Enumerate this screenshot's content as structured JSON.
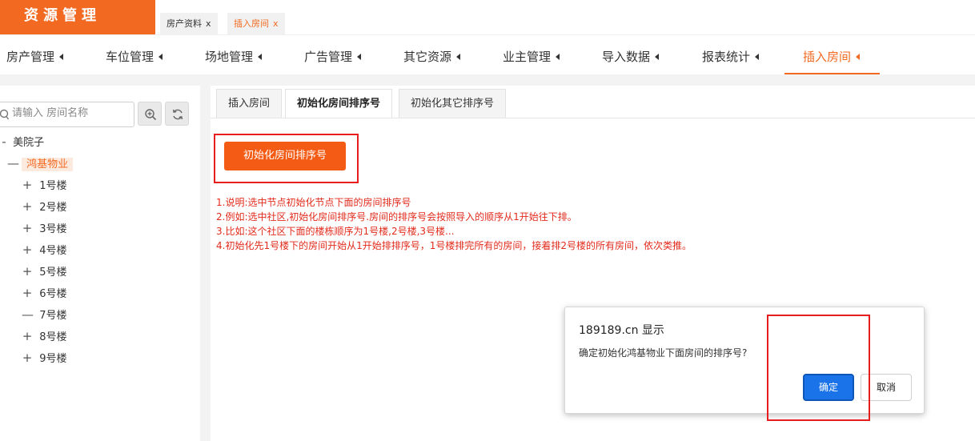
{
  "app": {
    "title": "资源管理"
  },
  "window_tabs": [
    {
      "label": "房产资料",
      "close": "x"
    },
    {
      "label": "插入房间",
      "close": "x"
    }
  ],
  "main_nav": [
    {
      "label": "房产管理"
    },
    {
      "label": "车位管理"
    },
    {
      "label": "场地管理"
    },
    {
      "label": "广告管理"
    },
    {
      "label": "其它资源"
    },
    {
      "label": "业主管理"
    },
    {
      "label": "导入数据"
    },
    {
      "label": "报表统计"
    },
    {
      "label": "插入房间",
      "active": true
    }
  ],
  "sidebar": {
    "search": {
      "placeholder": "请输入 房间名称"
    },
    "tree": [
      {
        "sign": "-",
        "label": "美院子"
      },
      {
        "sign": "—",
        "label": "鸿基物业",
        "selected": true
      },
      {
        "sign": "+",
        "label": "1号楼"
      },
      {
        "sign": "+",
        "label": "2号楼"
      },
      {
        "sign": "+",
        "label": "3号楼"
      },
      {
        "sign": "+",
        "label": "4号楼"
      },
      {
        "sign": "+",
        "label": "5号楼"
      },
      {
        "sign": "+",
        "label": "6号楼"
      },
      {
        "sign": "—",
        "label": "7号楼"
      },
      {
        "sign": "+",
        "label": "8号楼"
      },
      {
        "sign": "+",
        "label": "9号楼"
      }
    ]
  },
  "content": {
    "tabs": [
      {
        "label": "插入房间"
      },
      {
        "label": "初始化房间排序号",
        "active": true
      },
      {
        "label": "初始化其它排序号"
      }
    ],
    "init_button": "初始化房间排序号",
    "notes": [
      "1.说明:选中节点初始化节点下面的房间排序号",
      "2.例如:选中社区,初始化房间排序号.房间的排序号会按照导入的顺序从1开始往下排。",
      "3.比如:这个社区下面的楼栋顺序为1号楼,2号楼,3号楼...",
      "4.初始化先1号楼下的房间开始从1开始排排序号，1号楼排完所有的房间，接着排2号楼的所有房间，依次类推。"
    ]
  },
  "dialog": {
    "title": "189189.cn 显示",
    "message": "确定初始化鸿基物业下面房间的排序号?",
    "ok": "确定",
    "cancel": "取消"
  },
  "colors": {
    "brand": "#f26a21",
    "highlight": "#e81e1e",
    "notes": "#e22b1c",
    "dialog_ok": "#1a73e8"
  }
}
